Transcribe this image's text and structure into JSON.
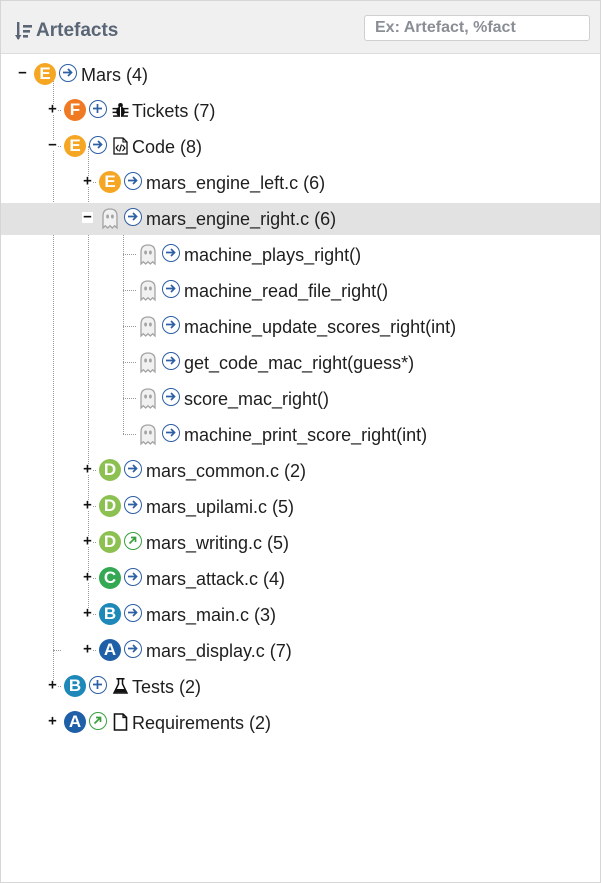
{
  "header": {
    "title": "Artefacts",
    "search_placeholder": "Ex: Artefact, %fact"
  },
  "colors": {
    "E": "#f5a623",
    "F": "#f07a24",
    "D": "#8cc152",
    "C": "#34a853",
    "B": "#1e88b8",
    "A": "#1f5fa8",
    "nav": "#2d5fa5",
    "nav_external": "#3aa040"
  },
  "tree": {
    "root": {
      "badge": "E",
      "label": "Mars (4)",
      "nav": "arrow"
    },
    "tickets": {
      "badge": "F",
      "label": "Tickets (7)",
      "nav": "plus",
      "icon": "bug-icon"
    },
    "code": {
      "badge": "E",
      "label": "Code (8)",
      "nav": "arrow",
      "icon": "code-file-icon",
      "files": [
        {
          "badge": "E",
          "label": "mars_engine_left.c (6)",
          "nav": "arrow"
        },
        {
          "badge": "ghost",
          "label": "mars_engine_right.c (6)",
          "nav": "arrow",
          "selected": true,
          "functions": [
            {
              "label": "machine_plays_right()"
            },
            {
              "label": "machine_read_file_right()"
            },
            {
              "label": "machine_update_scores_right(int)"
            },
            {
              "label": "get_code_mac_right(guess*)"
            },
            {
              "label": "score_mac_right()"
            },
            {
              "label": "machine_print_score_right(int)"
            }
          ]
        },
        {
          "badge": "D",
          "label": "mars_common.c (2)",
          "nav": "arrow"
        },
        {
          "badge": "D",
          "label": "mars_upilami.c (5)",
          "nav": "arrow"
        },
        {
          "badge": "D",
          "label": "mars_writing.c (5)",
          "nav": "external"
        },
        {
          "badge": "C",
          "label": "mars_attack.c (4)",
          "nav": "arrow"
        },
        {
          "badge": "B",
          "label": "mars_main.c (3)",
          "nav": "arrow"
        },
        {
          "badge": "A",
          "label": "mars_display.c (7)",
          "nav": "arrow"
        }
      ]
    },
    "tests": {
      "badge": "B",
      "label": "Tests (2)",
      "nav": "plus",
      "icon": "flask-icon"
    },
    "requirements": {
      "badge": "A",
      "label": "Requirements (2)",
      "nav": "external",
      "icon": "document-icon"
    }
  }
}
